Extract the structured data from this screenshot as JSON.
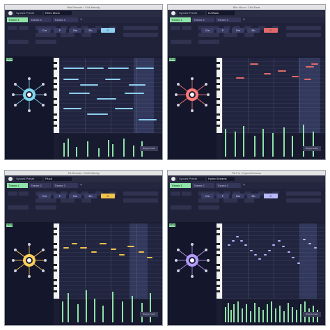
{
  "screenshots": [
    {
      "window_title": "Bite Remote / Chill Melody",
      "preset_label": "Synced Preset",
      "preset_name": "Retro Mono",
      "tabs": [
        "Theme 1",
        "Theme 2",
        "Theme 3"
      ],
      "active_tab": "Theme 1",
      "chord_labels": [
        "Cm",
        "F",
        "Gm",
        "Eb",
        "C"
      ],
      "selected_chord": "C",
      "new_badge": "NEW",
      "accent_color": "#8ecff0",
      "wheel_color": "#7fd8f0",
      "loop_region": [
        0.72,
        0.92
      ]
    },
    {
      "window_title": "Bite Moon / Chill Beat",
      "preset_label": "Synced Preset",
      "preset_name": "DJ Bass",
      "tabs": [
        "Theme 1",
        "Theme 2",
        "Theme 3"
      ],
      "active_tab": "Theme 1",
      "chord_labels": [
        "Cm",
        "F",
        "Gm",
        "Eb",
        "C"
      ],
      "selected_chord": "C",
      "new_badge": "NEW",
      "accent_color": "#e06a6a",
      "wheel_color": "#ff7a7a",
      "loop_region": [
        0.74,
        0.95
      ]
    },
    {
      "window_title": "Tilt Remote / Chill Melody",
      "preset_label": "Synced Preset",
      "preset_name": "Pluck",
      "tabs": [
        "Theme 1",
        "Theme 2",
        "Theme 3"
      ],
      "active_tab": "Theme 1",
      "chord_labels": [
        "Cm",
        "F",
        "Gm",
        "Eb",
        "C"
      ],
      "selected_chord": "C",
      "new_badge": "NEW",
      "accent_color": "#f2c24a",
      "wheel_color": "#ffcf5a",
      "loop_region": [
        0.68,
        0.86
      ]
    },
    {
      "window_title": "Tilt Fm / Hybrid Dreams",
      "preset_label": "Synced Preset",
      "preset_name": "Hybrid Dreams",
      "tabs": [
        "Theme 1",
        "Theme 2",
        "Theme 3"
      ],
      "active_tab": "Theme 1",
      "chord_labels": [
        "Cm",
        "F",
        "Gm",
        "Eb",
        "C"
      ],
      "selected_chord": "C",
      "new_badge": "NEW",
      "accent_color": "#b8b8ff",
      "wheel_color": "#b59bff",
      "loop_region": [
        0.76,
        0.92
      ]
    }
  ]
}
